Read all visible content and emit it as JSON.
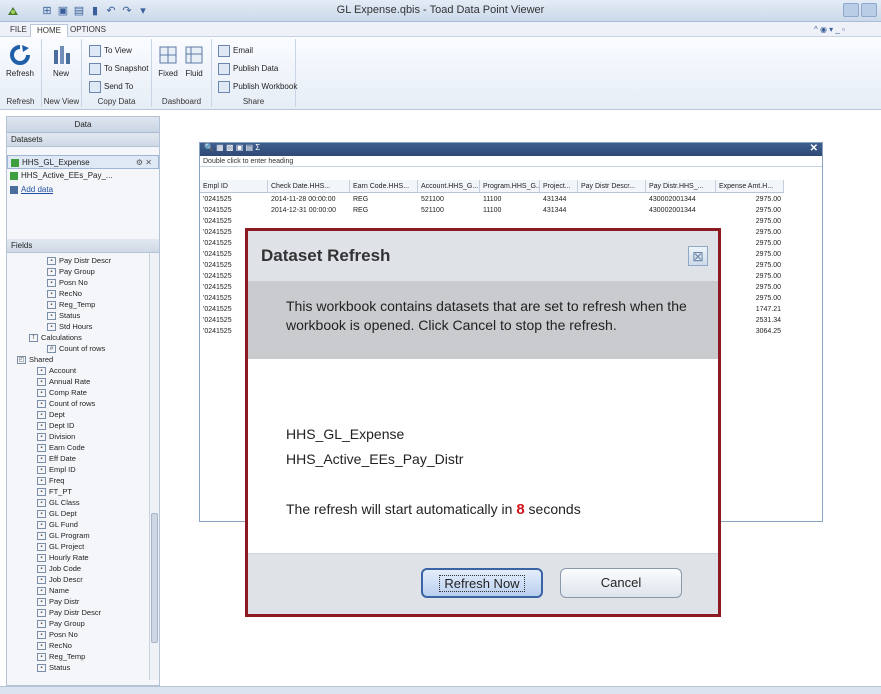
{
  "window": {
    "title": "GL Expense.qbis - Toad Data Point Viewer"
  },
  "menu": {
    "tabs": [
      "FILE",
      "HOME",
      "OPTIONS"
    ]
  },
  "ribbon": {
    "refresh_label": "Refresh",
    "new_label": "New",
    "to_view_label": "To View",
    "to_snapshot_label": "To Snapshot",
    "send_to_label": "Send To",
    "fixed_label": "Fixed",
    "fluid_label": "Fluid",
    "email_label": "Email",
    "publish_data_label": "Publish Data",
    "publish_workbook_label": "Publish Workbook",
    "groups": [
      "Refresh",
      "New View",
      "Copy Data",
      "Dashboard",
      "Share"
    ]
  },
  "left_panel": {
    "title": "Data",
    "datasets_header": "Datasets",
    "datasets": [
      "HHS_GL_Expense",
      "HHS_Active_EEs_Pay_..."
    ],
    "add_data_label": "Add data",
    "fields_header": "Fields",
    "fields_top": [
      "Pay Distr Descr",
      "Pay Group",
      "Posn No",
      "RecNo",
      "Reg_Temp",
      "Status",
      "Std Hours"
    ],
    "calculations_label": "Calculations",
    "count_of_rows_label": "Count of rows",
    "shared_label": "Shared",
    "shared_fields": [
      "Account",
      "Annual Rate",
      "Comp Rate",
      "Count of rows",
      "Dept",
      "Dept ID",
      "Division",
      "Earn Code",
      "Eff Date",
      "Empl ID",
      "Freq",
      "FT_PT",
      "GL Class",
      "GL Dept",
      "GL Fund",
      "GL Program",
      "GL Project",
      "Hourly Rate",
      "Job Code",
      "Job Descr",
      "Name",
      "Pay Distr",
      "Pay Distr Descr",
      "Pay Group",
      "Posn No",
      "RecNo",
      "Reg_Temp",
      "Status"
    ]
  },
  "grid": {
    "group_hint": "Double click to enter heading",
    "columns": [
      "Empl ID",
      "Check Date.HHS...",
      "Earn Code.HHS...",
      "Account.HHS_G...",
      "Program.HHS_G...",
      "Project...",
      "Pay Distr Descr...",
      "Pay Distr.HHS_...",
      "Expense Amt.H..."
    ],
    "rows": [
      [
        "'0241525",
        "2014-11-28 00:00:00",
        "REG",
        "521100",
        "11100",
        "431344",
        "",
        "430002001344",
        "2975.00"
      ],
      [
        "'0241525",
        "2014-12-31 00:00:00",
        "REG",
        "521100",
        "11100",
        "431344",
        "",
        "430002001344",
        "2975.00"
      ],
      [
        "'0241525",
        "",
        "",
        "",
        "",
        "",
        "",
        "",
        "2975.00"
      ],
      [
        "'0241525",
        "",
        "",
        "",
        "",
        "",
        "",
        "",
        "2975.00"
      ],
      [
        "'0241525",
        "",
        "",
        "",
        "",
        "",
        "",
        "",
        "2975.00"
      ],
      [
        "'0241525",
        "",
        "",
        "",
        "",
        "",
        "",
        "",
        "2975.00"
      ],
      [
        "'0241525",
        "",
        "",
        "",
        "",
        "",
        "",
        "",
        "2975.00"
      ],
      [
        "'0241525",
        "",
        "",
        "",
        "",
        "",
        "",
        "",
        "2975.00"
      ],
      [
        "'0241525",
        "",
        "",
        "",
        "",
        "",
        "",
        "",
        "2975.00"
      ],
      [
        "'0241525",
        "",
        "",
        "",
        "",
        "",
        "",
        "",
        "2975.00"
      ],
      [
        "'0241525",
        "",
        "",
        "",
        "",
        "",
        "",
        "",
        "1747.21"
      ],
      [
        "'0241525",
        "",
        "",
        "",
        "",
        "",
        "",
        "",
        "2531.34"
      ],
      [
        "'0241525",
        "",
        "",
        "",
        "",
        "",
        "",
        "",
        "3064.25"
      ]
    ]
  },
  "dialog": {
    "title": "Dataset Refresh",
    "message": "This workbook contains datasets that are set to refresh when the workbook is opened. Click Cancel to stop the refresh.",
    "datasets": [
      "HHS_GL_Expense",
      "HHS_Active_EEs_Pay_Distr"
    ],
    "countdown_prefix": "The refresh will start automatically in",
    "countdown_value": "8",
    "countdown_suffix": "seconds",
    "refresh_now_label": "Refresh Now",
    "cancel_label": "Cancel"
  },
  "colors": {
    "dialog_border": "#8b1a23",
    "countdown": "#d2141c",
    "accent": "#3b64a6"
  }
}
